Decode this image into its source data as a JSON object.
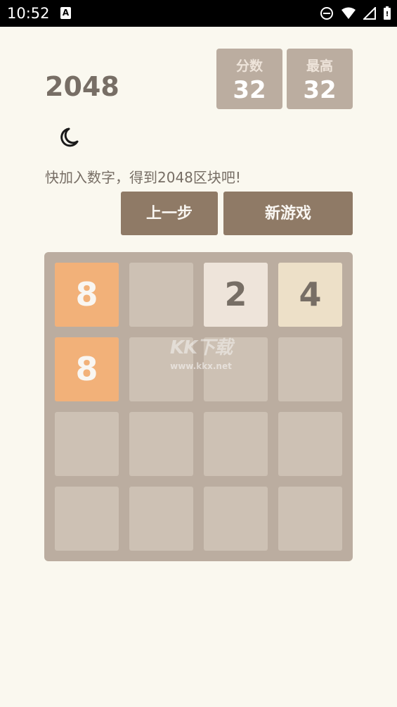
{
  "status_bar": {
    "time": "10:52",
    "notification_icon": "A",
    "icons": [
      "do-not-disturb-icon",
      "wifi-icon",
      "signal-icon",
      "battery-icon"
    ]
  },
  "header": {
    "title": "2048",
    "score": {
      "label": "分数",
      "value": "32"
    },
    "best": {
      "label": "最高",
      "value": "32"
    },
    "theme_icon": "moon-icon"
  },
  "tagline": "快加入数字，得到2048区块吧!",
  "buttons": {
    "undo": "上一步",
    "new_game": "新游戏"
  },
  "board": {
    "size": 4,
    "grid": [
      [
        8,
        0,
        2,
        4
      ],
      [
        8,
        0,
        0,
        0
      ],
      [
        0,
        0,
        0,
        0
      ],
      [
        0,
        0,
        0,
        0
      ]
    ]
  },
  "colors": {
    "background": "#faf8ef",
    "board": "#bbada0",
    "empty_cell": "#cdc1b4",
    "button": "#8f7a66",
    "dark_text": "#776e65",
    "tile_2": "#eee4da",
    "tile_4": "#ede0c8",
    "tile_8": "#f2b179"
  },
  "watermark": {
    "logo": "KK下载",
    "url": "www.kkx.net"
  }
}
